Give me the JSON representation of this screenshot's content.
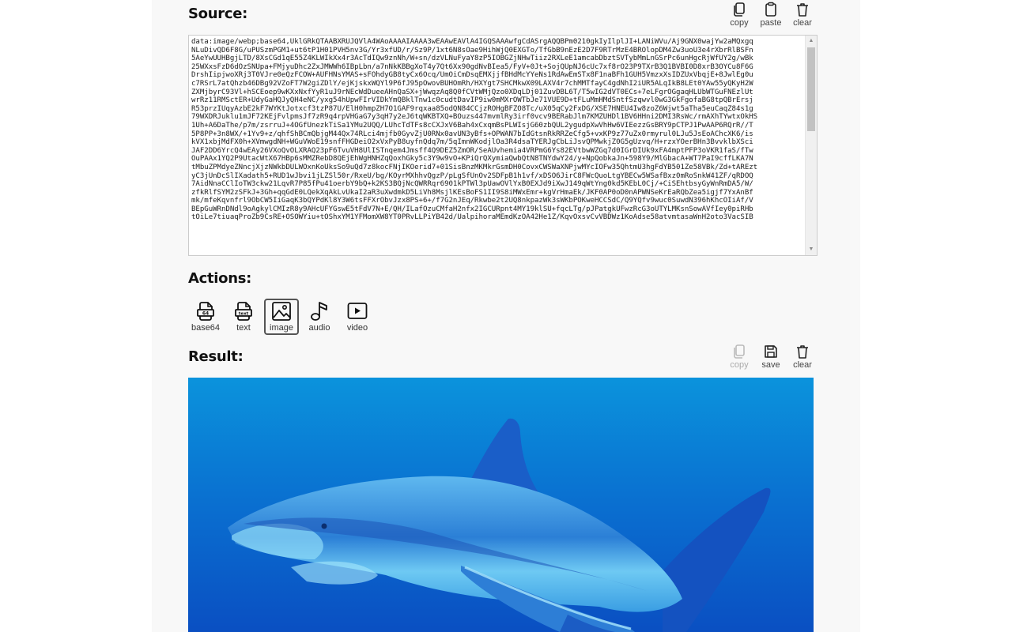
{
  "source": {
    "title": "Source:",
    "toolbar": [
      {
        "icon": "copy-icon",
        "label": "copy"
      },
      {
        "icon": "paste-icon",
        "label": "paste"
      },
      {
        "icon": "trash-icon",
        "label": "clear"
      }
    ],
    "value_lines": [
      "data:image/webp;base64,UklGRkQTAABXRUJQVlA4WAoAAAAIAAAA3wEAAwEAVlA4IGQSAAAwfgCdASrgAQQBPm0210gkIyIlplJI+LANiWVu/Aj9GNX0wajYw2aMQxgq",
      "NLuDivQD6F8G/uPUSzmPGM1+ut6tP1H01PVH5nv3G/Yr3xfUD/r/Sz9P/1xt6N8sOae9HihWjQ0EXGTo/TfGbB9nEzE2D7F9RTrMzE4BROlopDM4Zw3uoU3e4rXbrRlBSFn",
      "5AeYwUUHBgjLTD/8XsCGd1qE55Z4KLWIkXx4r3AcTdIQw9znNh/W+sn/dzVLNuFyaY8zP5IOBGZjNHwTiiz2RXLeE1amcabDbztSVTybMmLnGSrPc6unHgcRjWfUY2g/wBk",
      "25WXxsFzD6dOzSNUpa+FMjyuDhc2ZxJMWWh6IBpLbn/a7nNkKBBgXoT4y7Qt6Xx90gdNvBIea5/FyV+0Jt+SojQUpNJ6cUc7xf8rO23P9TXrB3Q1BVBI0D8xrB3OYCu8F6G",
      "DrshIipjwoXRj3T0VJre0eQzFCOW+AUFHNsYMAS+sFOhdyGB8tyCx6Ocq/UmOiCmDsqEMXjjfBHdMcYYeNs1RdAwEmSTx8F1naBFh1GUH5VmzxXsIDZUxVbqjE+8JwlEg0u",
      "c7RSrL7atQhzb46DBg92VZoFT7W2giZDlY/ejKjskxWQYl9P6fJ95pOwovBUHOmRh/HXYgt7SHCMkwX09LAXV4r7chMMTfayC4gdNhI2iUR5ALqIkB8LEt0YAw55yQKyH2W",
      "ZXMjbyrC93Vl+hSCEoep9wKXxNxfYyR1uJ9rNEcWdDueeAHnQaSX+jWwqzAq8Q0fCVtWMjQzo0XDqLDj01ZuvDBL6T/T5wIG2dVT0ECs+7eLFgrOGgaqHLUbWTGuFNEzlUt",
      "wrRz11RMSctER+UdyGaHQJyQH4eNC/yxg54hUpwFIrVIDkYmQBklTnw1c0cudtDavIP9iw0mMXrOWTbJe71VUE9D+tFLuMmHMdSntfSzqwvl0wG3GkFgofaBG8tpQBrErsj",
      "R53przIUqyAzbE2kF7WYKtJotxcf3tzP87U/ElH0hmpZH7O1GAF9rqxaa85odQN84CCjzROHgBFZO8Tc/uX05qCy2FxDG/XSE7HNEU4Iw8zoZ6Wjwt5aTha5euCaqZ84s1g",
      "79WXDRJuklu1mJF72KEjFvlpmsJf7zR9q4rpVHGaG7y3qH7y2eJ6tqWKBTXQ+BOuzs447mvmlRy3irf0vcv9BERabJlm7KMZUHDl1BV6HHni2DMI3RsWc/rmAXhTYwtxOkHS",
      "1Uh+A6DaThe/p7m/zsrruJ+4OGfUnezkTiSa1YMu2UQQ/LUhcTdTFs8cCXJxV6Bah4xCxqmBsPLWIsjG60zbQUL2ygudpXwVhHw6VIEezzGsBRY9pCTPJ1PwAAP6RQrR//T",
      "5P8PP+3n8WX/+1Yv9+z/qhfShBCmQbjgM44Qx74RLci4mjfb0GyvZjU0RNx0avUN3yBfs+OPWAN7bIdGtsnRkRRZeCfg5+vxKP9z77uZx0rmyrul0LJu5JsEoAChcXK6/is",
      "kVX1xbjMdFX0h+XVmwgdNH+WGuVWoE19snfFHGDeiO2xVxPyB8uyfnQdq7m/5qImnWKodjlOa3R4dsaTYERJgCbLiJsvQPMwkjZ0G5gUzvq/H+rzxYOerBHn3BvvklbXSci",
      "JAF2DD6YrcQ4wEAy26VXoQvOLXRAQ23pF6TvuVH8UlISTnqem4Jmsff4Q9DEZ5ZmOR/SeAUvhemia4VRPmG6Ys82EVtbwWZGq7d0IGrDIUk9xFA4mptPFP3oVKR1faS/fTw",
      "OuPAAx1YQ2P9UtacWtX67HBp6sMMZRebD8QEjEhWgHNHZqQoxhGky5c3Y9w9vO+KPiQrQXymiaQwbQtN8TNYdwY24/y+NpQobkaJn+598Y9/MlGbacA+WT7PaI9cffLKA7N",
      "tMbuZPMdyeZNncjXjzNWkbDULWOxnKoUksSo9uQd7z8kocFNjIKOerid7+01SisBnzMKMkrGsmDH0CovxCWSWaXNPjwMYcIOFw35QhtmU3hgFdYB501Ze58VBk/Zd+tAREzt",
      "yC3jUnDcSlIXadath5+RUD1wJbvi1jLZSl50r/RxeU/bg/KOyrMXhhvQgzP/pLgSfUnOv2SDFpB1h1vf/xDSO6JirC8FWcQuoLtgYBECw5WSafBxz0mRoSnkW41ZF/qRDOQ",
      "7AidNnaCClIoTW3ckw21LqvR7P85fPu41oerbY9bQ+k2KS3BQjNcQWRRqr6901kPTWl3pUawOVlYxB0EXJd9iXwJ149qWtYng0kd5KEbL0Cj/+CiSEhtbsyGyWnRmDA5/W/",
      "zfkRlfSYM2zSFkJ+3Gh+qqGdE0LQekXqAkLvUkaI2aR3uXwdmkD5LiVh8MsjlKEsBoFS1II9S8iMWxEmr+kgVrHmaEk/JKF0AP0oD0nAPWNSeKrEaRQbZea5igjf7YxAnBf",
      "mk/mfeKqvnfrl9ObCW5IiGaqK3bQYPdKl8Y3W6tsFFXrObvJzx8PS+6+/f7G2nJEq/Rkwbe2t2UQ8nkpazWk3sWKbPOKweHCCSdC/Q9YQfv9wuc0SuwdN396hKhcOIiAf/V",
      "BEpGuWRnDNdl9oAgkylCMIzR8y9AHcUFYGswE5tFdV7N+E/QH/ILafOzuCMfaH2nfx2IGCURpnt4MY19klSU+fqcLTg/pJPatgkUFwzRcG3oUTYLMKsnSowAVfIey0piRHb",
      "tOiLe7tiuaqProZb9CsRE+OSOWYiu+tOShxYM1YFMomXW8YT0PRvLLPiYB42d/UalpihoraMEmdKzOA42He1Z/KqvOxsvCvVBDWz1KoAdse58atvmtasaWnH2oto3VacSIB"
    ]
  },
  "actions": {
    "title": "Actions:",
    "buttons": [
      {
        "icon": "base64-file-icon",
        "label": "base64",
        "active": false
      },
      {
        "icon": "text-file-icon",
        "label": "text",
        "active": false
      },
      {
        "icon": "image-icon",
        "label": "image",
        "active": true
      },
      {
        "icon": "audio-note-icon",
        "label": "audio",
        "active": false
      },
      {
        "icon": "video-play-icon",
        "label": "video",
        "active": false
      }
    ]
  },
  "result": {
    "title": "Result:",
    "toolbar": [
      {
        "icon": "copy-icon",
        "label": "copy",
        "disabled": true
      },
      {
        "icon": "save-icon",
        "label": "save",
        "disabled": false
      },
      {
        "icon": "trash-icon",
        "label": "clear",
        "disabled": false
      }
    ],
    "image_description": "Grey reef shark swimming in blue water"
  },
  "colors": {
    "panel_bg": "#f8f8f8",
    "page_bg": "#ffffff",
    "water_top": "#0a8fd8",
    "water_bottom": "#0a55c4"
  }
}
